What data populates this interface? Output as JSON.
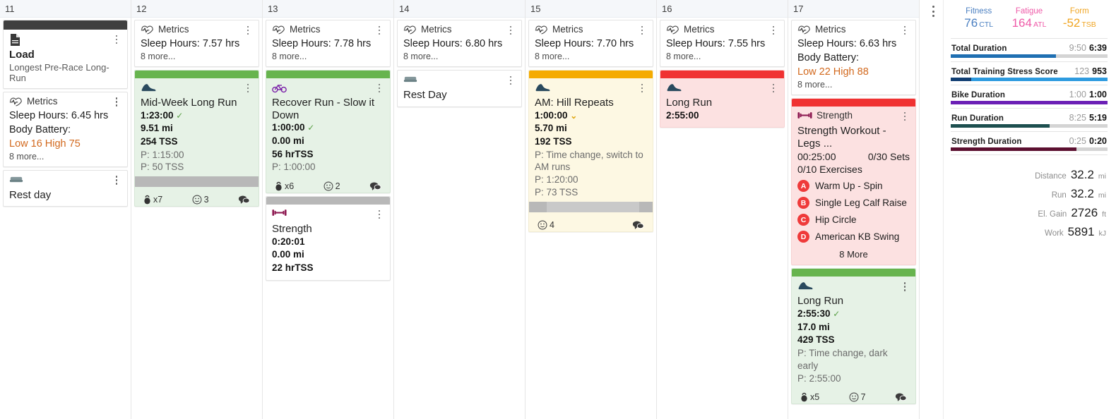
{
  "calendar": {
    "days": [
      {
        "date": "11",
        "cards": [
          {
            "kind": "load",
            "accent": "dark",
            "icon": "document-icon",
            "title": "Load",
            "subtitle": "Longest Pre-Race Long-Run"
          },
          {
            "kind": "metrics",
            "type_label": "Metrics",
            "lines": [
              {
                "text": "Sleep Hours: 6.45 hrs",
                "color": "normal"
              },
              {
                "text": "Body Battery:",
                "color": "normal"
              },
              {
                "text": "Low 16 High 75",
                "color": "orange"
              }
            ],
            "more": "8 more..."
          },
          {
            "kind": "rest",
            "icon": "bed-icon",
            "title": "Rest day"
          }
        ]
      },
      {
        "date": "12",
        "cards": [
          {
            "kind": "metrics",
            "type_label": "Metrics",
            "lines": [
              {
                "text": "Sleep Hours: 7.57 hrs",
                "color": "normal"
              }
            ],
            "more": "8 more..."
          },
          {
            "kind": "workout",
            "accent": "green",
            "icon": "running-shoe-icon",
            "title": "Mid-Week Long Run",
            "stats": [
              {
                "text": "1:23:00",
                "mark": "check"
              },
              {
                "text": "9.51 mi"
              },
              {
                "text": "254 TSS"
              }
            ],
            "planned": [
              "P: 1:15:00",
              "P: 50 TSS"
            ],
            "band": {
              "fill_pct": 100
            },
            "footer": [
              {
                "icon": "kettlebell-icon",
                "text": "x7"
              },
              {
                "icon": "smiley-icon",
                "text": "3"
              },
              {
                "icon": "comment-icon",
                "text": ""
              }
            ]
          }
        ]
      },
      {
        "date": "13",
        "cards": [
          {
            "kind": "metrics",
            "type_label": "Metrics",
            "lines": [
              {
                "text": "Sleep Hours: 7.78 hrs",
                "color": "normal"
              }
            ],
            "more": "8 more..."
          },
          {
            "kind": "workout",
            "accent": "green",
            "icon": "bicycle-icon",
            "title": "Recover Run - Slow it Down",
            "stats": [
              {
                "text": "1:00:00",
                "mark": "check"
              },
              {
                "text": "0.00 mi"
              },
              {
                "text": "56 hrTSS"
              }
            ],
            "planned": [
              "P: 1:00:00"
            ],
            "footer": [
              {
                "icon": "kettlebell-icon",
                "text": "x6"
              },
              {
                "icon": "smiley-icon",
                "text": "2"
              },
              {
                "icon": "comment-icon",
                "text": ""
              }
            ]
          },
          {
            "kind": "workout",
            "accent": "gray",
            "icon": "dumbbell-icon",
            "title": "Strength",
            "stats": [
              {
                "text": "0:20:01"
              },
              {
                "text": "0.00 mi"
              },
              {
                "text": "22 hrTSS"
              }
            ]
          }
        ]
      },
      {
        "date": "14",
        "cards": [
          {
            "kind": "metrics",
            "type_label": "Metrics",
            "lines": [
              {
                "text": "Sleep Hours: 6.80 hrs",
                "color": "normal"
              }
            ],
            "more": "8 more..."
          },
          {
            "kind": "rest",
            "icon": "bed-icon",
            "title": "Rest Day"
          }
        ]
      },
      {
        "date": "15",
        "cards": [
          {
            "kind": "metrics",
            "type_label": "Metrics",
            "lines": [
              {
                "text": "Sleep Hours: 7.70 hrs",
                "color": "normal"
              }
            ],
            "more": "8 more..."
          },
          {
            "kind": "workout",
            "accent": "yellow",
            "icon": "running-shoe-icon",
            "title": "AM: Hill Repeats",
            "stats": [
              {
                "text": "1:00:00",
                "mark": "chevron"
              },
              {
                "text": "5.70 mi"
              },
              {
                "text": "192 TSS"
              }
            ],
            "planned": [
              "P: Time change, switch to AM runs",
              "P: 1:20:00",
              "P: 73 TSS"
            ],
            "band": {
              "fill_pct": 75
            },
            "footer": [
              {
                "icon": "smiley-icon",
                "text": "4"
              },
              {
                "icon": "comment-icon",
                "text": ""
              }
            ]
          }
        ]
      },
      {
        "date": "16",
        "cards": [
          {
            "kind": "metrics",
            "type_label": "Metrics",
            "lines": [
              {
                "text": "Sleep Hours: 7.55 hrs",
                "color": "normal"
              }
            ],
            "more": "8 more..."
          },
          {
            "kind": "workout",
            "accent": "red",
            "icon": "running-shoe-icon",
            "title": "Long Run",
            "stats": [
              {
                "text": "2:55:00"
              }
            ]
          }
        ]
      },
      {
        "date": "17",
        "cards": [
          {
            "kind": "metrics",
            "type_label": "Metrics",
            "lines": [
              {
                "text": "Sleep Hours: 6.63 hrs",
                "color": "normal"
              },
              {
                "text": "Body Battery:",
                "color": "normal"
              },
              {
                "text": "Low 22 High 88",
                "color": "orange"
              }
            ],
            "more": "8 more..."
          },
          {
            "kind": "strength",
            "accent": "red",
            "icon": "dumbbell-icon",
            "type_label": "Strength",
            "title": "Strength Workout - Legs ...",
            "duration": "00:25:00",
            "sets": "0/30 Sets",
            "exercises_count": "0/10 Exercises",
            "exercises": [
              {
                "badge": "A",
                "name": "Warm Up - Spin"
              },
              {
                "badge": "B",
                "name": "Single Leg Calf Raise"
              },
              {
                "badge": "C",
                "name": "Hip Circle"
              },
              {
                "badge": "D",
                "name": "American KB Swing"
              }
            ],
            "more": "8 More"
          },
          {
            "kind": "workout",
            "accent": "green",
            "icon": "running-shoe-icon",
            "title": "Long Run",
            "stats": [
              {
                "text": "2:55:30",
                "mark": "check"
              },
              {
                "text": "17.0 mi"
              },
              {
                "text": "429 TSS"
              }
            ],
            "planned": [
              "P: Time change, dark early",
              "P: 2:55:00"
            ],
            "footer": [
              {
                "icon": "kettlebell-icon",
                "text": "x5"
              },
              {
                "icon": "smiley-icon",
                "text": "7"
              },
              {
                "icon": "comment-icon",
                "text": ""
              }
            ]
          }
        ]
      }
    ]
  },
  "sidebar": {
    "pmc": [
      {
        "label": "Fitness",
        "value": "76",
        "unit": "CTL",
        "color": "#4a7fc1"
      },
      {
        "label": "Fatigue",
        "value": "164",
        "unit": "ATL",
        "color": "#ef5aa8"
      },
      {
        "label": "Form",
        "value": "-52",
        "unit": "TSB",
        "color": "#f0a522"
      }
    ],
    "metrics": [
      {
        "name": "Total Duration",
        "planned": "9:50",
        "actual": "6:39",
        "fill_pct": 67,
        "fill_color": "#1f6fb2",
        "track_color": "#d4d4d4"
      },
      {
        "name": "Total Training Stress Score",
        "planned": "123",
        "actual": "953",
        "fill_pct": 100,
        "fill_color": "#2e9bdf",
        "fill2_pct": 13,
        "fill2_color": "#123f73",
        "track_color": "#d4d4d4"
      },
      {
        "name": "Bike Duration",
        "planned": "1:00",
        "actual": "1:00",
        "fill_pct": 100,
        "fill_color": "#6b1fb5",
        "track_color": "#d4d4d4"
      },
      {
        "name": "Run Duration",
        "planned": "8:25",
        "actual": "5:19",
        "fill_pct": 63,
        "fill_color": "#1d4f4f",
        "track_color": "#d4d4d4"
      },
      {
        "name": "Strength Duration",
        "planned": "0:25",
        "actual": "0:20",
        "fill_pct": 80,
        "fill_color": "#5c1030",
        "track_color": "#d4d4d4"
      }
    ],
    "totals": [
      {
        "label": "Distance",
        "value": "32.2",
        "unit": "mi"
      },
      {
        "label": "Run",
        "value": "32.2",
        "unit": "mi"
      },
      {
        "label": "El. Gain",
        "value": "2726",
        "unit": "ft"
      },
      {
        "label": "Work",
        "value": "5891",
        "unit": "kJ"
      }
    ]
  }
}
